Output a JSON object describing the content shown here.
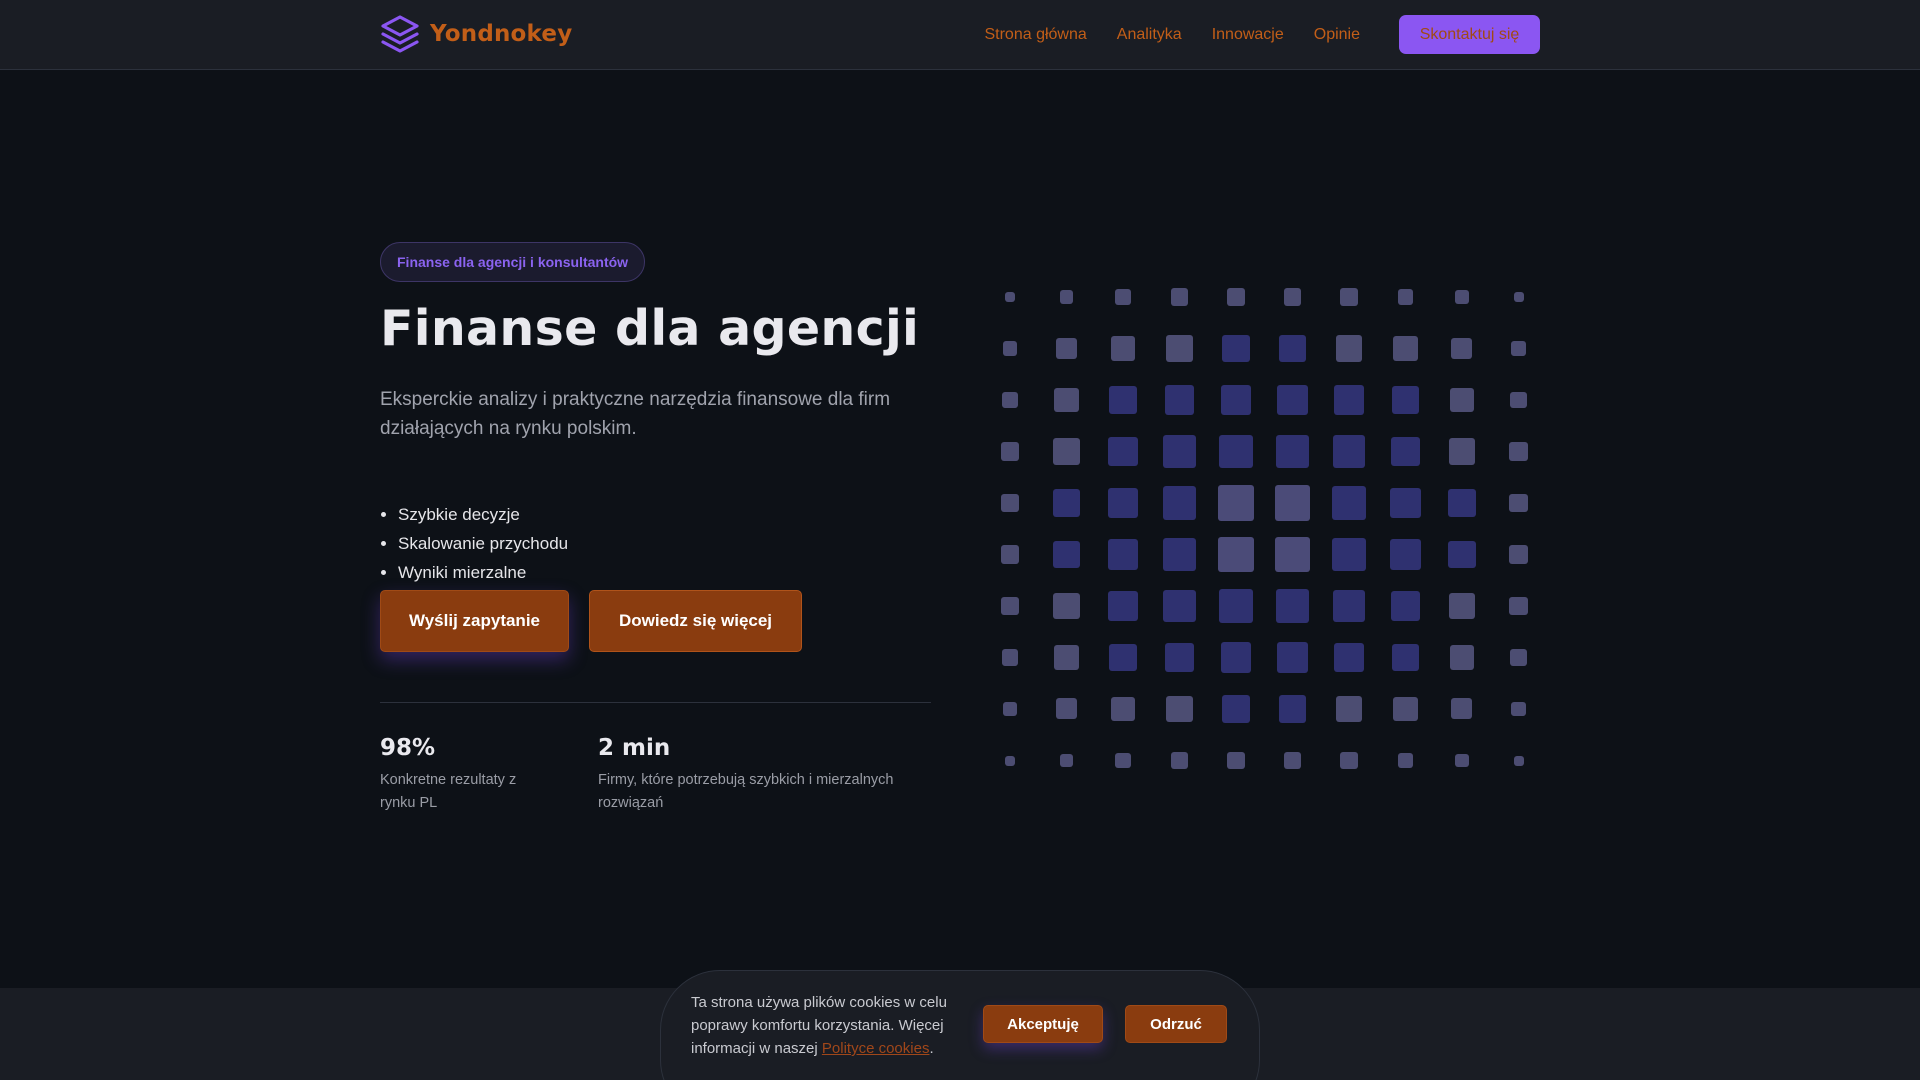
{
  "brand": {
    "name": "Yondnokey",
    "icon": "layers-icon",
    "accent": "#c25e18",
    "primary": "#8b56f2"
  },
  "nav": {
    "links": [
      "Strona główna",
      "Analityka",
      "Innowacje",
      "Opinie"
    ],
    "cta": "Skontaktuj się"
  },
  "hero": {
    "badge": "Finanse dla agencji i konsultantów",
    "title": "Finanse dla agencji",
    "subtitle": "Eksperckie analizy i praktyczne narzędzia finansowe dla firm działających na rynku polskim.",
    "features": [
      "Szybkie decyzje",
      "Skalowanie przychodu",
      "Wyniki mierzalne"
    ],
    "primary_button": "Wyślij zapytanie",
    "secondary_button": "Dowiedz się więcej",
    "stats": [
      {
        "value": "98%",
        "label": "Konkretne rezultaty z rynku PL"
      },
      {
        "value": "2 min",
        "label": "Firmy, które potrzebują szybkich i mierzalnych rozwiązań"
      }
    ]
  },
  "cookie": {
    "text": "Ta strona używa plików cookies w celu poprawy komfortu korzystania. Więcej informacji w naszej",
    "link": "Polityce cookies",
    "suffix": ".",
    "accept": "Akceptuję",
    "reject": "Odrzuć"
  }
}
